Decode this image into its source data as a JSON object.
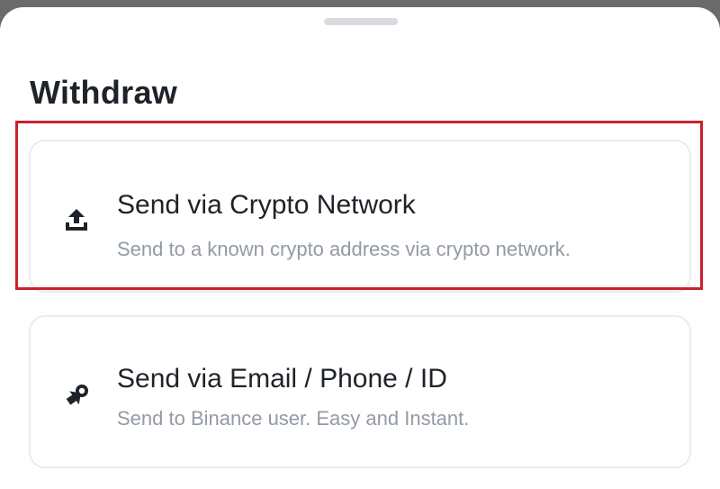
{
  "sheet": {
    "title": "Withdraw"
  },
  "options": [
    {
      "title": "Send via Crypto Network",
      "description": "Send to a known crypto address via crypto network.",
      "icon": "upload-icon"
    },
    {
      "title": "Send via Email / Phone / ID",
      "description": "Send to Binance user. Easy and Instant.",
      "icon": "send-user-icon"
    }
  ],
  "colors": {
    "text_primary": "#1e2329",
    "text_secondary": "#929aa5",
    "card_border": "#eaecef",
    "highlight_border": "#c8222c",
    "sheet_background": "#ffffff",
    "backdrop": "#6b6b6b"
  }
}
